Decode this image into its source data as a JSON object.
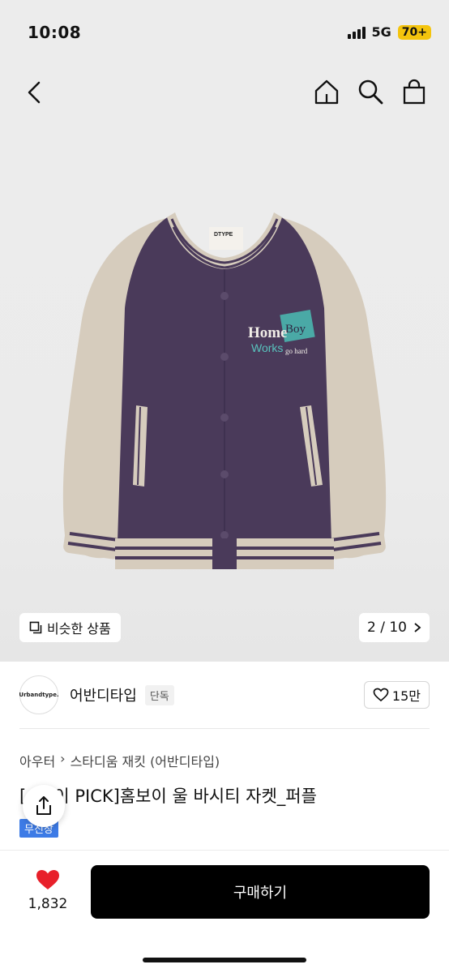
{
  "status": {
    "time": "10:08",
    "network": "5G",
    "battery": "70+"
  },
  "nav": {
    "back_icon": "chevron-left-icon",
    "home_icon": "home-icon",
    "search_icon": "search-icon",
    "cart_icon": "shopping-bag-icon"
  },
  "product_image": {
    "label_tag": "DTYPE",
    "patch_line1_a": "Home",
    "patch_line1_b": "Boy",
    "patch_line2_a": "Works",
    "patch_line2_b": "go hard",
    "colors": {
      "body": "#4a3a5a",
      "sleeve": "#d6ccbd",
      "stripe": "#4a3a5a"
    }
  },
  "gallery": {
    "similar_label": "비슷한 상품",
    "pager": "2 / 10"
  },
  "brand": {
    "logo_text": "Urbandtype.",
    "name": "어반디타입",
    "badge": "단독",
    "likes": "15만"
  },
  "breadcrumb": {
    "category": "아우터",
    "sub": "스타디움 재킷 (어반디타입)"
  },
  "product": {
    "title": "[   ]송이 PICK]홈보이 울 바시티 자켓_퍼플",
    "tag": "무진장"
  },
  "bottom": {
    "heart_count": "1,832",
    "buy_label": "구매하기"
  },
  "accent": {
    "heart": "#e8202a",
    "tag": "#3d7be6",
    "buy": "#000000"
  }
}
